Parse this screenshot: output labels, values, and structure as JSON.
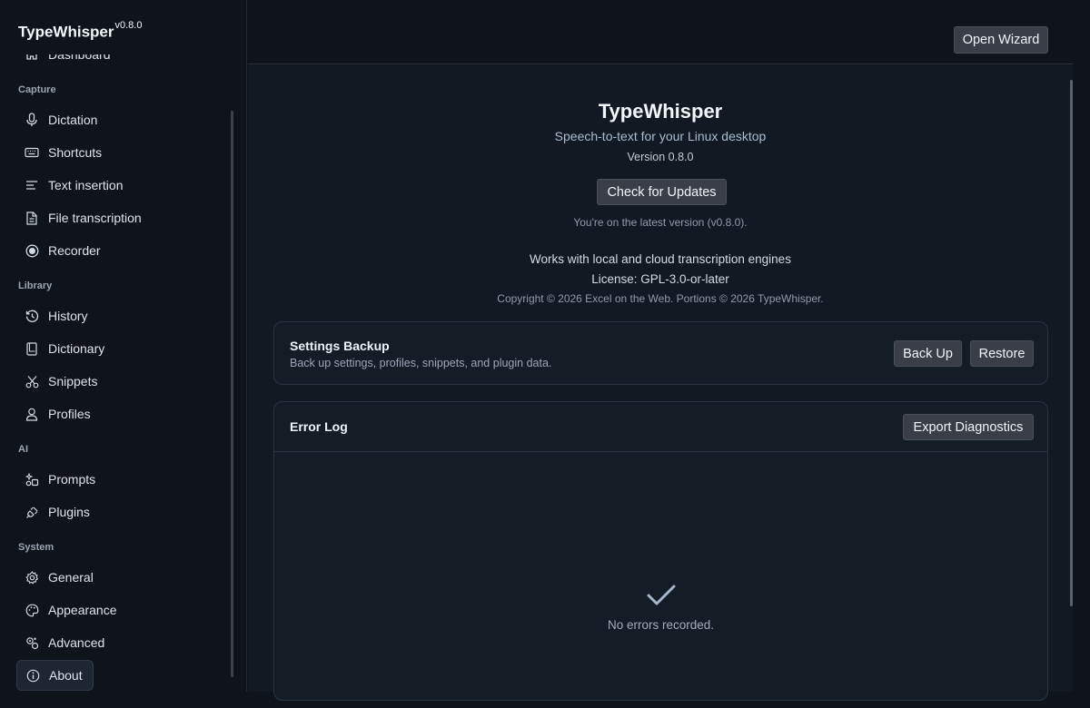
{
  "sidebar": {
    "app_name": "TypeWhisper",
    "version": "v0.8.0",
    "partial_item": "Dashboard",
    "sections": {
      "capture": "Capture",
      "library": "Library",
      "ai": "AI",
      "system": "System"
    },
    "items": {
      "dictation": "Dictation",
      "shortcuts": "Shortcuts",
      "text_insertion": "Text insertion",
      "file_transcription": "File transcription",
      "recorder": "Recorder",
      "history": "History",
      "dictionary": "Dictionary",
      "snippets": "Snippets",
      "profiles": "Profiles",
      "prompts": "Prompts",
      "plugins": "Plugins",
      "general": "General",
      "appearance": "Appearance",
      "advanced": "Advanced",
      "about": "About"
    }
  },
  "header": {
    "open_wizard": "Open Wizard"
  },
  "about": {
    "title": "TypeWhisper",
    "tagline": "Speech-to-text for your Linux desktop",
    "version": "Version 0.8.0",
    "check_updates": "Check for Updates",
    "update_status": "You're on the latest version (v0.8.0).",
    "engines": "Works with local and cloud transcription engines",
    "license": "License: GPL-3.0-or-later",
    "copyright": "Copyright © 2026 Excel on the Web. Portions © 2026 TypeWhisper."
  },
  "backup": {
    "title": "Settings Backup",
    "desc": "Back up settings, profiles, snippets, and plugin data.",
    "back_up": "Back Up",
    "restore": "Restore"
  },
  "error_log": {
    "title": "Error Log",
    "export": "Export Diagnostics",
    "empty": "No errors recorded."
  },
  "colors": {
    "accent": "#a7b8cc",
    "background": "#0f141b",
    "card": "#141c26"
  }
}
